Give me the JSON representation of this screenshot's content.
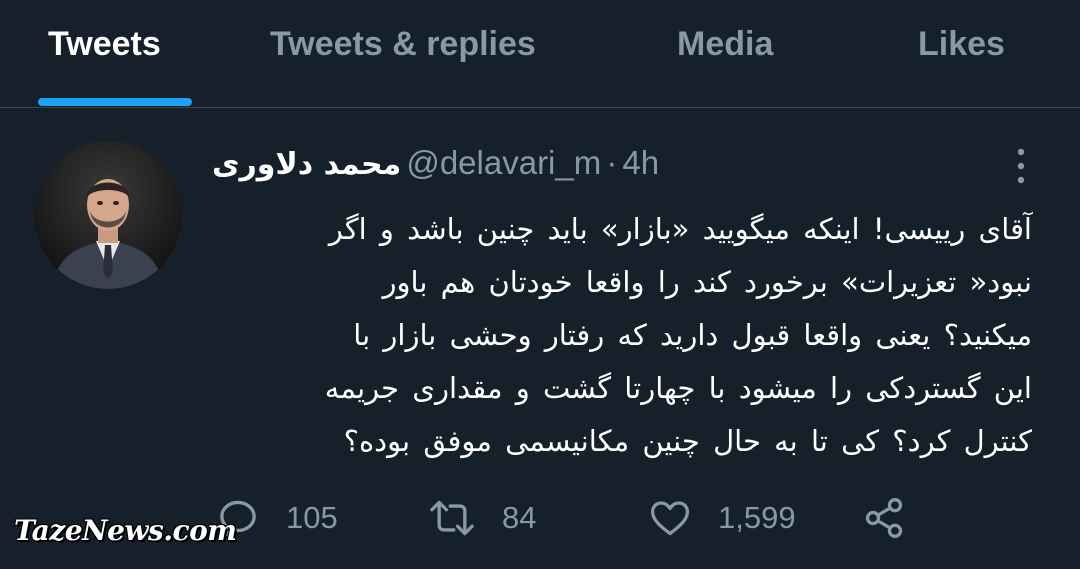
{
  "tabs": [
    {
      "label": "Tweets",
      "active": true
    },
    {
      "label": "Tweets & replies",
      "active": false
    },
    {
      "label": "Media",
      "active": false
    },
    {
      "label": "Likes",
      "active": false
    }
  ],
  "tweet": {
    "display_name": "محمد دلاوری",
    "handle": "@delavari_m",
    "separator": "·",
    "time": "4h",
    "text_lines": [
      "آقای رییسی! اینکه میگویید «بازار» باید چنین باشد و اگر",
      "نبود« تعزیرات» برخورد کند را واقعا خودتان هم باور",
      "میکنید؟ یعنی واقعا قبول دارید که رفتار وحشی بازار با",
      "این گستردکی را میشود با چهارتا گشت و مقداری جریمه",
      "کنترل کرد؟ کی تا به حال چنین مکانیسمی موفق بوده؟"
    ],
    "replies": "105",
    "retweets": "84",
    "likes": "1,599"
  },
  "icons": {
    "more": "more-vertical-icon",
    "reply": "reply-icon",
    "retweet": "retweet-icon",
    "like": "heart-icon",
    "share": "share-icon"
  },
  "colors": {
    "background": "#15202b",
    "accent": "#1da1f2",
    "muted": "#8899a6",
    "divider": "#38444d"
  },
  "watermark": "TazeNews.com"
}
